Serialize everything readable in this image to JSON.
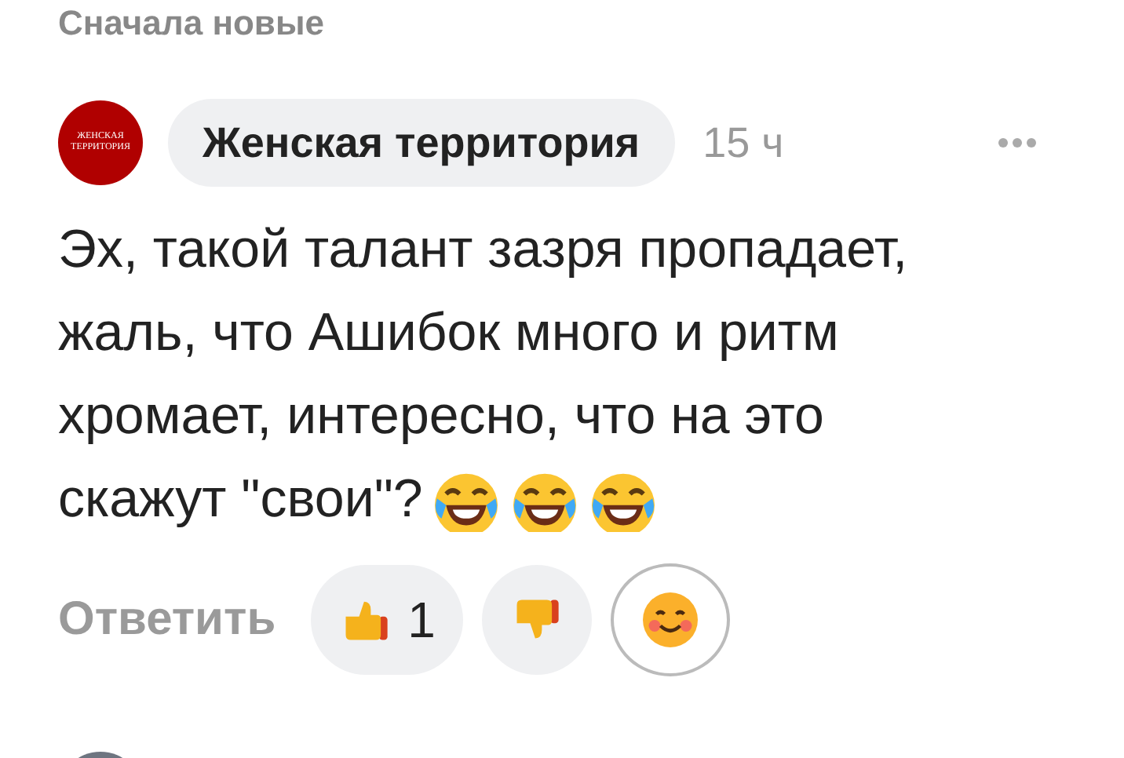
{
  "sort_label": "Сначала новые",
  "comment": {
    "avatar_text": "ЖЕНСКАЯ ТЕРРИТОРИЯ",
    "author": "Женская территория",
    "time": "15 ч",
    "text_lines": [
      "Эх, такой талант зазря пропадает,",
      "жаль, что Ашибок много и ритм",
      "хромает, интересно, что на это",
      "скажут \"свои\"?"
    ],
    "reply": "Ответить",
    "reactions": [
      {
        "kind": "like",
        "count": "1"
      },
      {
        "kind": "dislike"
      },
      {
        "kind": "add"
      }
    ]
  }
}
